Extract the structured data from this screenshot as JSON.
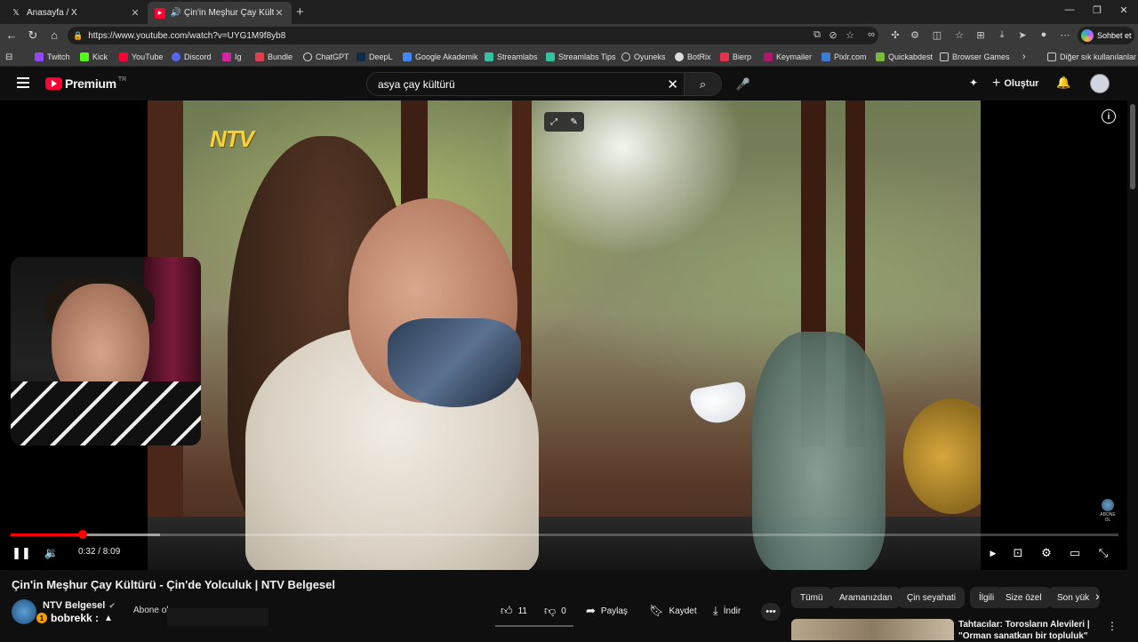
{
  "browser": {
    "tabs": [
      {
        "title": "Anasayfa / X",
        "favicon": "x-icon"
      },
      {
        "title": "Çin'in Meşhur Çay Kültürü - Ç",
        "favicon": "youtube-icon"
      }
    ],
    "url": "https://www.youtube.com/watch?v=UYG1M9f8yb8",
    "copilot_label": "Sohbet et",
    "bookmarks": [
      "Twitch",
      "Kick",
      "YouTube",
      "Discord",
      "Ig",
      "Bundle",
      "ChatGPT",
      "DeepL",
      "Google Akademik",
      "Streamlabs",
      "Streamlabs Tips",
      "Oyuneks",
      "BotRix",
      "Bierp",
      "Keymailer",
      "Pixlr.com",
      "Quickabdest",
      "Browser Games"
    ],
    "other_bookmarks": "Diğer sık kullanılanlar"
  },
  "youtube": {
    "logo_text": "Premium",
    "logo_country": "TR",
    "search_value": "asya çay kültürü",
    "create_label": "Oluştur"
  },
  "player": {
    "channel_logo": "NTV",
    "current_time": "0:32",
    "duration": "8:09",
    "time_display": "0:32 / 8:09",
    "progress_fraction": 0.065,
    "buffered_fraction": 0.135,
    "watermark_text": "ABONE OL"
  },
  "video": {
    "title": "Çin'in Meşhur Çay Kültürü - Çin'de Yolculuk | NTV Belgesel",
    "channel": "NTV Belgesel",
    "subscribe_label": "Abone ol",
    "likes": "11",
    "dislikes": "0",
    "share_label": "Paylaş",
    "save_label": "Kaydet",
    "download_label": "İndir"
  },
  "overlay_chat": {
    "username": "bobrekk :",
    "badge": "1"
  },
  "chips": [
    "Tümü",
    "Aramanızdan",
    "Çin seyahati",
    "İlgili",
    "Size özel",
    "Son yük"
  ],
  "recommendation": {
    "title": "Tahtacılar: Torosların Alevileri | \"Orman sanatkarı bir topluluk\""
  }
}
